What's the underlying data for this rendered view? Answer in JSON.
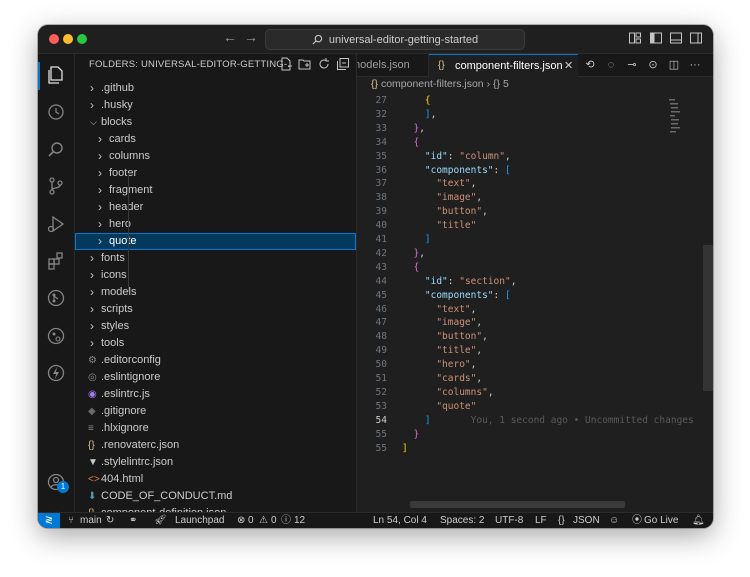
{
  "window": {
    "search_text": "universal-editor-getting-started"
  },
  "sidebar": {
    "header": "FOLDERS: UNIVERSAL-EDITOR-GETTING-...",
    "items": [
      {
        "label": ".github",
        "type": "folder",
        "depth": 0,
        "open": false
      },
      {
        "label": ".husky",
        "type": "folder",
        "depth": 0,
        "open": false
      },
      {
        "label": "blocks",
        "type": "folder",
        "depth": 0,
        "open": true
      },
      {
        "label": "cards",
        "type": "folder",
        "depth": 1,
        "open": false
      },
      {
        "label": "columns",
        "type": "folder",
        "depth": 1,
        "open": false
      },
      {
        "label": "footer",
        "type": "folder",
        "depth": 1,
        "open": false
      },
      {
        "label": "fragment",
        "type": "folder",
        "depth": 1,
        "open": false
      },
      {
        "label": "header",
        "type": "folder",
        "depth": 1,
        "open": false
      },
      {
        "label": "hero",
        "type": "folder",
        "depth": 1,
        "open": false
      },
      {
        "label": "quote",
        "type": "folder",
        "depth": 1,
        "open": false,
        "selected": true
      },
      {
        "label": "fonts",
        "type": "folder",
        "depth": 0,
        "open": false
      },
      {
        "label": "icons",
        "type": "folder",
        "depth": 0,
        "open": false
      },
      {
        "label": "models",
        "type": "folder",
        "depth": 0,
        "open": false
      },
      {
        "label": "scripts",
        "type": "folder",
        "depth": 0,
        "open": false
      },
      {
        "label": "styles",
        "type": "folder",
        "depth": 0,
        "open": false
      },
      {
        "label": "tools",
        "type": "folder",
        "depth": 0,
        "open": false
      },
      {
        "label": ".editorconfig",
        "type": "file",
        "icon": "gear-icon",
        "glyph": "⚙",
        "color": "#8a8a8a"
      },
      {
        "label": ".eslintignore",
        "type": "file",
        "icon": "eslint-icon",
        "glyph": "◎",
        "color": "#8a8a8a"
      },
      {
        "label": ".eslintrc.js",
        "type": "file",
        "icon": "eslint-icon",
        "glyph": "◉",
        "color": "#a07cf0"
      },
      {
        "label": ".gitignore",
        "type": "file",
        "icon": "git-icon",
        "glyph": "◆",
        "color": "#6a6a6a"
      },
      {
        "label": ".hlxignore",
        "type": "file",
        "icon": "lines-icon",
        "glyph": "≡",
        "color": "#8a8a8a"
      },
      {
        "label": ".renovaterc.json",
        "type": "file",
        "icon": "json-icon",
        "glyph": "{}",
        "color": "#e2c08d"
      },
      {
        "label": ".stylelintrc.json",
        "type": "file",
        "icon": "stylelint-icon",
        "glyph": "▼",
        "color": "#cccccc"
      },
      {
        "label": "404.html",
        "type": "file",
        "icon": "html-icon",
        "glyph": "<>",
        "color": "#e37933"
      },
      {
        "label": "CODE_OF_CONDUCT.md",
        "type": "file",
        "icon": "markdown-icon",
        "glyph": "⬇",
        "color": "#519aba"
      },
      {
        "label": "component-definition.json",
        "type": "file",
        "icon": "json-icon",
        "glyph": "{}",
        "color": "#e2c08d"
      }
    ]
  },
  "editor": {
    "tabs": [
      {
        "label": "models.json",
        "active": false
      },
      {
        "label": "component-filters.json",
        "active": true
      }
    ],
    "breadcrumb": {
      "file": "component-filters.json",
      "symbol": "5"
    },
    "blame": "You, 1 second ago • Uncommitted changes",
    "lines": [
      {
        "n": "27",
        "parts": [
          [
            "    ",
            ""
          ],
          [
            "{",
            "b2"
          ]
        ]
      },
      {
        "n": "32",
        "parts": [
          [
            "    ",
            ""
          ],
          [
            "]",
            "b3"
          ],
          [
            ",",
            ""
          ]
        ]
      },
      {
        "n": "33",
        "parts": [
          [
            "  ",
            ""
          ],
          [
            "}",
            "b1"
          ],
          [
            ",",
            ""
          ]
        ]
      },
      {
        "n": "34",
        "parts": [
          [
            "  ",
            ""
          ],
          [
            "{",
            "b1"
          ]
        ]
      },
      {
        "n": "35",
        "parts": [
          [
            "    ",
            ""
          ],
          [
            "\"id\"",
            "key"
          ],
          [
            ": ",
            ""
          ],
          [
            "\"column\"",
            "str"
          ],
          [
            ",",
            ""
          ]
        ]
      },
      {
        "n": "36",
        "parts": [
          [
            "    ",
            ""
          ],
          [
            "\"components\"",
            "key"
          ],
          [
            ": ",
            ""
          ],
          [
            "[",
            "b3"
          ]
        ]
      },
      {
        "n": "37",
        "parts": [
          [
            "      ",
            ""
          ],
          [
            "\"text\"",
            "str"
          ],
          [
            ",",
            ""
          ]
        ]
      },
      {
        "n": "38",
        "parts": [
          [
            "      ",
            ""
          ],
          [
            "\"image\"",
            "str"
          ],
          [
            ",",
            ""
          ]
        ]
      },
      {
        "n": "39",
        "parts": [
          [
            "      ",
            ""
          ],
          [
            "\"button\"",
            "str"
          ],
          [
            ",",
            ""
          ]
        ]
      },
      {
        "n": "40",
        "parts": [
          [
            "      ",
            ""
          ],
          [
            "\"title\"",
            "str"
          ]
        ]
      },
      {
        "n": "41",
        "parts": [
          [
            "    ",
            ""
          ],
          [
            "]",
            "b3"
          ]
        ]
      },
      {
        "n": "42",
        "parts": [
          [
            "  ",
            ""
          ],
          [
            "}",
            "b1"
          ],
          [
            ",",
            ""
          ]
        ]
      },
      {
        "n": "43",
        "parts": [
          [
            "  ",
            ""
          ],
          [
            "{",
            "b1"
          ]
        ]
      },
      {
        "n": "44",
        "parts": [
          [
            "    ",
            ""
          ],
          [
            "\"id\"",
            "key"
          ],
          [
            ": ",
            ""
          ],
          [
            "\"section\"",
            "str"
          ],
          [
            ",",
            ""
          ]
        ]
      },
      {
        "n": "45",
        "parts": [
          [
            "    ",
            ""
          ],
          [
            "\"components\"",
            "key"
          ],
          [
            ": ",
            ""
          ],
          [
            "[",
            "b3"
          ]
        ]
      },
      {
        "n": "46",
        "parts": [
          [
            "      ",
            ""
          ],
          [
            "\"text\"",
            "str"
          ],
          [
            ",",
            ""
          ]
        ]
      },
      {
        "n": "47",
        "parts": [
          [
            "      ",
            ""
          ],
          [
            "\"image\"",
            "str"
          ],
          [
            ",",
            ""
          ]
        ]
      },
      {
        "n": "48",
        "parts": [
          [
            "      ",
            ""
          ],
          [
            "\"button\"",
            "str"
          ],
          [
            ",",
            ""
          ]
        ]
      },
      {
        "n": "49",
        "parts": [
          [
            "      ",
            ""
          ],
          [
            "\"title\"",
            "str"
          ],
          [
            ",",
            ""
          ]
        ]
      },
      {
        "n": "50",
        "parts": [
          [
            "      ",
            ""
          ],
          [
            "\"hero\"",
            "str"
          ],
          [
            ",",
            ""
          ]
        ]
      },
      {
        "n": "51",
        "parts": [
          [
            "      ",
            ""
          ],
          [
            "\"cards\"",
            "str"
          ],
          [
            ",",
            ""
          ]
        ]
      },
      {
        "n": "52",
        "parts": [
          [
            "      ",
            ""
          ],
          [
            "\"columns\"",
            "str"
          ],
          [
            ",",
            ""
          ]
        ]
      },
      {
        "n": "53",
        "parts": [
          [
            "      ",
            ""
          ],
          [
            "\"quote\"",
            "str"
          ]
        ]
      },
      {
        "n": "54",
        "parts": [
          [
            "    ",
            ""
          ],
          [
            "]",
            "b3"
          ]
        ]
      },
      {
        "n": "55",
        "parts": [
          [
            "  ",
            ""
          ],
          [
            "}",
            "b1"
          ]
        ]
      },
      {
        "n": "55b",
        "parts": [
          [
            "",
            ""
          ],
          [
            "]",
            "b2"
          ]
        ]
      }
    ],
    "line_numbers": [
      "27",
      "32",
      "33",
      "34",
      "35",
      "36",
      "37",
      "38",
      "39",
      "40",
      "41",
      "42",
      "43",
      "44",
      "45",
      "46",
      "47",
      "48",
      "49",
      "50",
      "51",
      "52",
      "53",
      "54",
      "55"
    ],
    "current_line": "54"
  },
  "statusbar": {
    "branch": "main",
    "launchpad": "Launchpad",
    "errors": "0",
    "warnings": "0",
    "info": "12",
    "position": "Ln 54, Col 4",
    "spaces": "Spaces: 2",
    "encoding": "UTF-8",
    "eol": "LF",
    "language": "JSON",
    "golive": "Go Live"
  },
  "accounts_badge": "1"
}
